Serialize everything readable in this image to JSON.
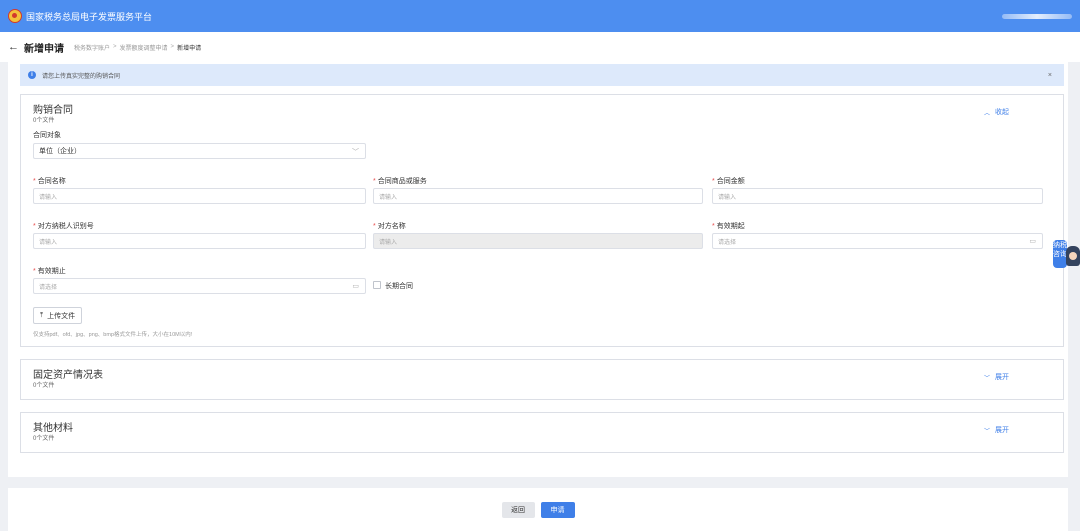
{
  "header": {
    "title": "国家税务总局电子发票服务平台"
  },
  "breadcrumb": {
    "back_icon": "arrow-left-icon",
    "page_title": "新增申请",
    "items": [
      "税务数字账户",
      "发票额度调整申请",
      "新增申请"
    ],
    "separator": ">"
  },
  "alert": {
    "text": "请您上传真实完整的购销合同",
    "close": "×"
  },
  "contract_panel": {
    "title": "购销合同",
    "count": "0个文件",
    "toggle_label": "收起",
    "toggle_icon": "chevron-up-icon",
    "object_label": "合同对象",
    "object_value": "单位（企业）",
    "fields": {
      "name": {
        "label": "合同名称",
        "placeholder": "请输入"
      },
      "goods": {
        "label": "合同商品或服务",
        "placeholder": "请输入"
      },
      "amount": {
        "label": "合同金额",
        "placeholder": "请输入"
      },
      "taxid": {
        "label": "对方纳税人识别号",
        "placeholder": "请输入"
      },
      "party": {
        "label": "对方名称",
        "placeholder": "请输入"
      },
      "start": {
        "label": "有效期起",
        "placeholder": "请选择"
      },
      "end": {
        "label": "有效期止",
        "placeholder": "请选择"
      }
    },
    "long_term_label": "长期合同",
    "upload_label": "上传文件",
    "upload_hint": "仅支持pdf、ofd、jpg、png、bmp格式文件上传，大小在10M以内!"
  },
  "fixed_assets_panel": {
    "title": "固定资产情况表",
    "count": "0个文件",
    "toggle_label": "展开"
  },
  "other_panel": {
    "title": "其他材料",
    "count": "0个文件",
    "toggle_label": "展开"
  },
  "assistant": {
    "text": "纳税咨询",
    "icon": "assistant-avatar-icon"
  },
  "footer": {
    "back_label": "返回",
    "submit_label": "申请"
  },
  "colors": {
    "primary": "#4d8ef0",
    "accent": "#3f7fe8",
    "required": "#e84c4c",
    "alert_bg": "#dde9fb"
  }
}
